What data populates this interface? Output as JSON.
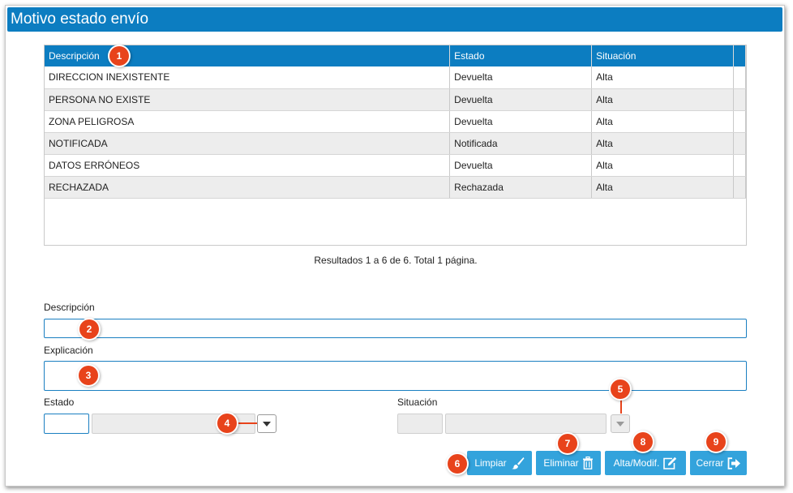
{
  "window": {
    "title": "Motivo estado envío"
  },
  "grid": {
    "columns": [
      "Descripción",
      "Estado",
      "Situación"
    ],
    "rows": [
      {
        "descripcion": "DIRECCION INEXISTENTE",
        "estado": "Devuelta",
        "situacion": "Alta"
      },
      {
        "descripcion": "PERSONA NO EXISTE",
        "estado": "Devuelta",
        "situacion": "Alta"
      },
      {
        "descripcion": "ZONA PELIGROSA",
        "estado": "Devuelta",
        "situacion": "Alta"
      },
      {
        "descripcion": "NOTIFICADA",
        "estado": "Notificada",
        "situacion": "Alta"
      },
      {
        "descripcion": "DATOS ERRÓNEOS",
        "estado": "Devuelta",
        "situacion": "Alta"
      },
      {
        "descripcion": "RECHAZADA",
        "estado": "Rechazada",
        "situacion": "Alta"
      }
    ]
  },
  "pager": {
    "text": "Resultados 1 a 6 de 6. Total 1 página."
  },
  "form": {
    "descripcion_label": "Descripción",
    "explicacion_label": "Explicación",
    "estado_label": "Estado",
    "situacion_label": "Situación"
  },
  "buttons": {
    "limpiar": "Limpiar",
    "eliminar": "Eliminar",
    "alta_modif": "Alta/Modif.",
    "cerrar": "Cerrar"
  },
  "callouts": [
    "1",
    "2",
    "3",
    "4",
    "5",
    "6",
    "7",
    "8",
    "9"
  ],
  "colors": {
    "header_blue": "#0c7dc1",
    "button_blue": "#33a3dc",
    "callout_red": "#e8431b"
  }
}
